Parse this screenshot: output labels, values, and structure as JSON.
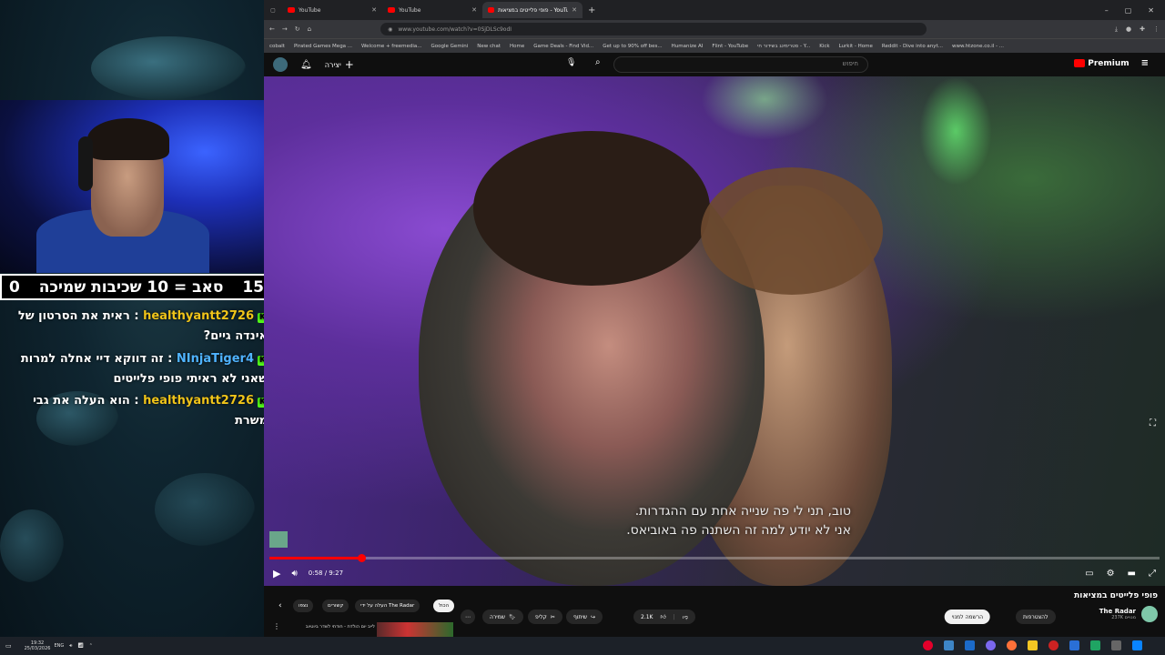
{
  "overlay": {
    "score_left": "0",
    "score_label": "סאב = 10 שכיבות שמיכה",
    "score_right": "15",
    "chat": [
      {
        "user": "healthyantt2726",
        "message": ": ראית את הסרטון של אינדה גיים?"
      },
      {
        "user": "NInjaTiger4",
        "message": ": זה דווקא דיי אחלה למרות שאני לא ראיתי פופי פלייטים"
      },
      {
        "user": "healthyantt2726",
        "message": ": הוא העלה את גבי משרת"
      }
    ]
  },
  "browser": {
    "tabs": [
      {
        "title": "YouTube",
        "active": false
      },
      {
        "title": "YouTube",
        "active": false
      },
      {
        "title": "פופי פלייטים במציאות - YouTube",
        "active": true
      }
    ],
    "url": "www.youtube.com/watch?v=0SjDLSc9odI",
    "bookmarks": [
      "cobalt",
      "Pirated Games Mega ...",
      "Welcome + freemedia...",
      "Google Gemini",
      "New chat",
      "Home",
      "Game Deals - Find Vid...",
      "Get up to 90% off bes...",
      "Humanize AI",
      "Flint - YouTube",
      "סטרימינג בשידור חי - Y...",
      "Kick",
      "Lurkit - Home",
      "Reddit - Dive into anyt...",
      "www.htzone.co.il - ..."
    ]
  },
  "youtube": {
    "search_placeholder": "חיפוש",
    "create_label": "יצירה",
    "logo_text": "Premium",
    "accent": "#ff0000",
    "video": {
      "subtitle_line1": "טוב, תני לי פה שנייה אחת עם ההגדרות.",
      "subtitle_line2": "אני לא יודע למה זה השתנה פה באוביאס.",
      "time": "0:58 / 9:27",
      "progress": 0.103
    },
    "title": "פופי פלייטים במציאות",
    "channel_name": "The Radar",
    "channel_subs": "237K מנויים",
    "subscribe_label": "הרשמה למנוי",
    "join_label": "להצטרפות",
    "likes": "2.1K",
    "share_label": "שיתוף",
    "clip_label": "קליפ",
    "save_label": "שמירה",
    "chips": [
      "הכול",
      "העלה על ידי The Radar",
      "קשורים",
      "נצפו"
    ],
    "next_video_title": "לייב יום הולדת - חודתי לשדר ביוטיוב"
  },
  "taskbar": {
    "lang": "ENG",
    "time": "19:32",
    "date": "25/03/2026"
  }
}
